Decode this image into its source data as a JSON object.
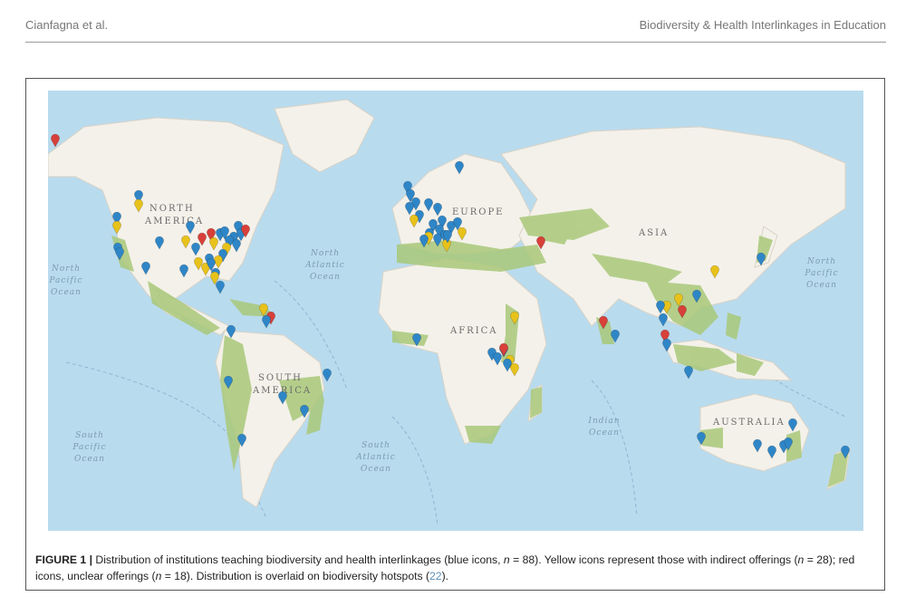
{
  "running_head": {
    "authors": "Cianfagna et al.",
    "journal_section": "Biodiversity & Health Interlinkages in Education"
  },
  "figure": {
    "continent_labels": [
      "NORTH AMERICA",
      "SOUTH AMERICA",
      "EUROPE",
      "AFRICA",
      "ASIA",
      "AUSTRALIA"
    ],
    "ocean_labels": [
      "North Atlantic Ocean",
      "North Pacific Ocean",
      "North Pacific Ocean",
      "South Pacific Ocean",
      "South Atlantic Ocean",
      "Indian Ocean"
    ],
    "colors": {
      "ocean": "#b9dbee",
      "land": "#f4f1ea",
      "hotspot": "#a9c97a",
      "blue_icon": "#2f86c7",
      "yellow_icon": "#e8c21b",
      "red_icon": "#d8403a"
    },
    "caption": {
      "label": "FIGURE 1 |",
      "text_1": " Distribution of institutions teaching biodiversity and health interlinkages (blue icons, ",
      "n_sym_1": "n",
      "text_2": " = 88). Yellow icons represent those with indirect offerings (",
      "n_sym_2": "n",
      "text_3": " = 28); red icons, unclear offerings (",
      "n_sym_3": "n",
      "text_4": " = 18). Distribution is overlaid on biodiversity hotspots (",
      "ref": "22",
      "text_5": ")."
    }
  }
}
